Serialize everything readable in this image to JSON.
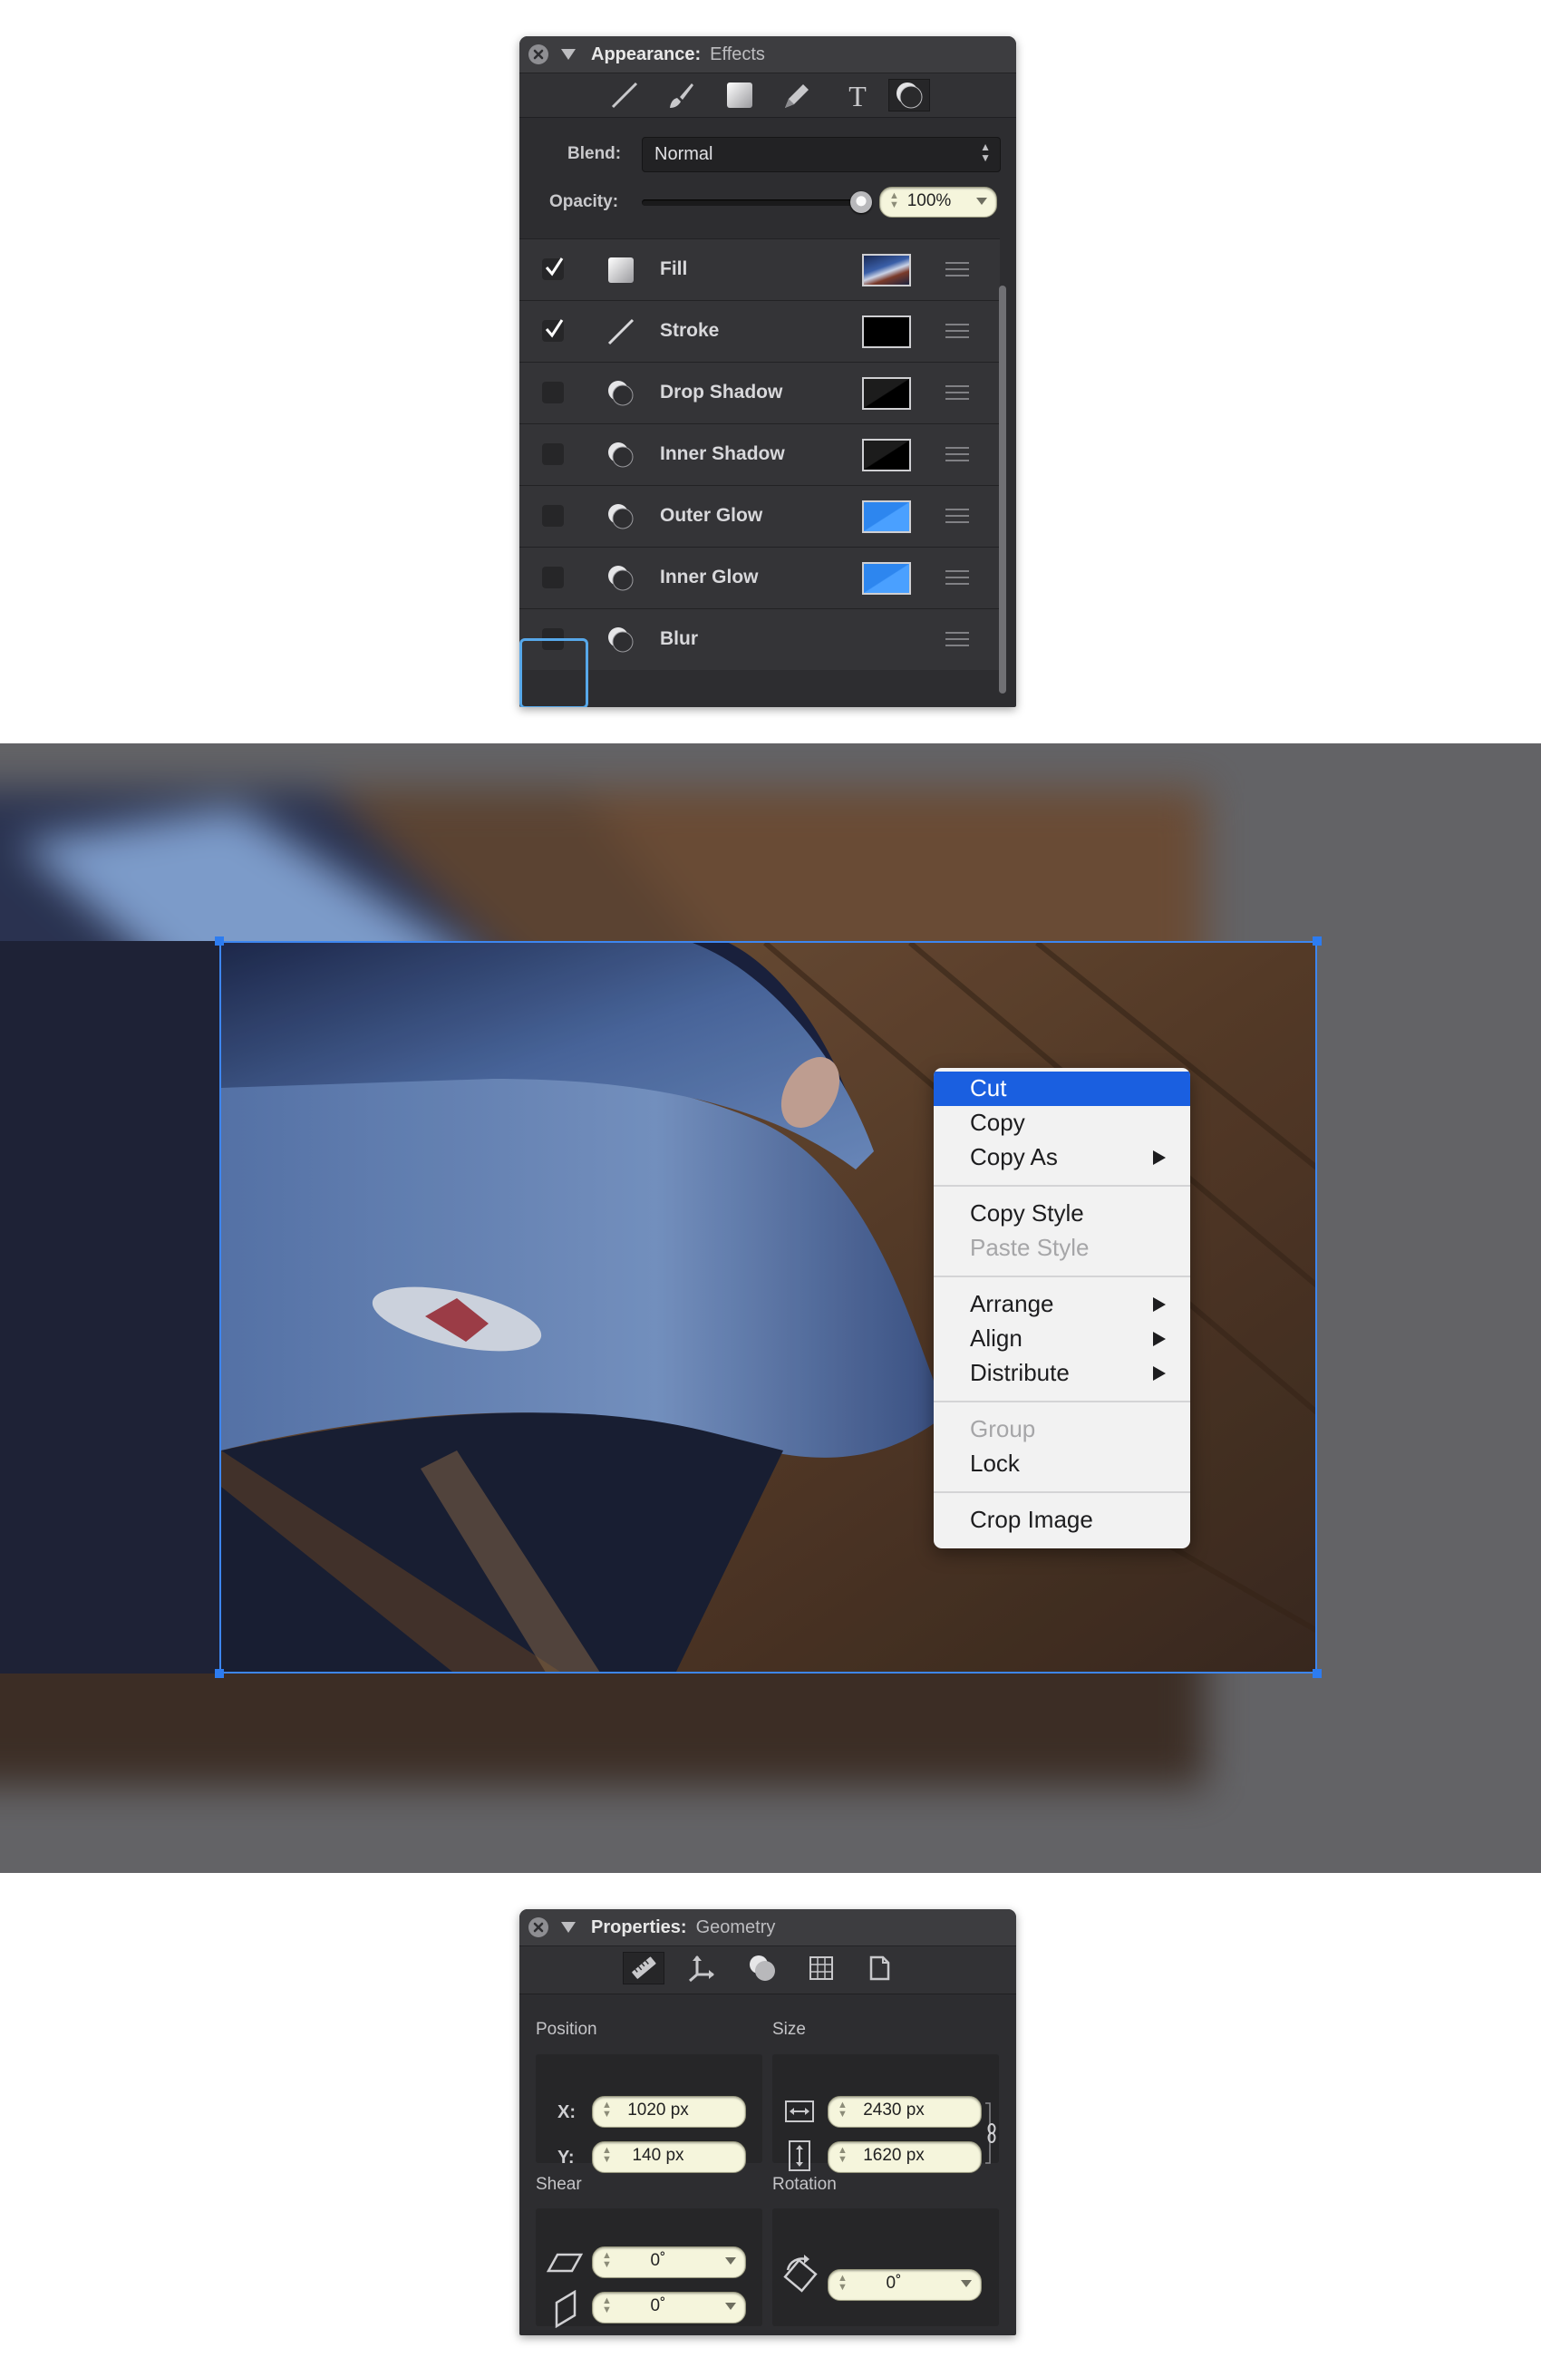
{
  "appearance_panel": {
    "title": "Appearance:",
    "subtitle": "Effects",
    "toolbar_icons": [
      "line-tool-icon",
      "brush-tool-icon",
      "fill-tool-icon",
      "pen-tool-icon",
      "text-tool-icon",
      "effects-tool-icon"
    ],
    "blend_label": "Blend:",
    "blend_value": "Normal",
    "opacity_label": "Opacity:",
    "opacity_value": "100%",
    "opacity_level": 1.0,
    "effects": [
      {
        "name": "Fill",
        "checked": true,
        "icon": "fill-swatch-icon",
        "swatch": "image"
      },
      {
        "name": "Stroke",
        "checked": true,
        "icon": "stroke-line-icon",
        "swatch": "#000000"
      },
      {
        "name": "Drop Shadow",
        "checked": false,
        "icon": "shadow-circle-icon",
        "swatch": "#000000"
      },
      {
        "name": "Inner Shadow",
        "checked": false,
        "icon": "shadow-circle-icon",
        "swatch": "#000000"
      },
      {
        "name": "Outer Glow",
        "checked": false,
        "icon": "shadow-circle-icon",
        "swatch": "#2a8cf5"
      },
      {
        "name": "Inner Glow",
        "checked": false,
        "icon": "shadow-circle-icon",
        "swatch": "#2a8cf5"
      },
      {
        "name": "Blur",
        "checked": false,
        "icon": "shadow-circle-icon",
        "swatch": ""
      }
    ],
    "add_label": "+"
  },
  "context_menu": {
    "items": [
      {
        "label": "Cut",
        "highlighted": true,
        "disabled": false,
        "submenu": false
      },
      {
        "label": "Copy",
        "highlighted": false,
        "disabled": false,
        "submenu": false
      },
      {
        "label": "Copy As",
        "highlighted": false,
        "disabled": false,
        "submenu": true
      },
      {
        "label": "Copy Style",
        "highlighted": false,
        "disabled": false,
        "submenu": false
      },
      {
        "label": "Paste Style",
        "highlighted": false,
        "disabled": true,
        "submenu": false
      },
      {
        "label": "Arrange",
        "highlighted": false,
        "disabled": false,
        "submenu": true
      },
      {
        "label": "Align",
        "highlighted": false,
        "disabled": false,
        "submenu": true
      },
      {
        "label": "Distribute",
        "highlighted": false,
        "disabled": false,
        "submenu": true
      },
      {
        "label": "Group",
        "highlighted": false,
        "disabled": true,
        "submenu": false
      },
      {
        "label": "Lock",
        "highlighted": false,
        "disabled": false,
        "submenu": false
      },
      {
        "label": "Crop Image",
        "highlighted": false,
        "disabled": false,
        "submenu": false
      }
    ]
  },
  "properties_panel": {
    "title": "Properties:",
    "subtitle": "Geometry",
    "toolbar_icons": [
      "ruler-icon",
      "anchor-icon",
      "shapes-icon",
      "grid-icon",
      "document-icon"
    ],
    "position_label": "Position",
    "size_label": "Size",
    "x_label": "X:",
    "x_value": "1020 px",
    "y_label": "Y:",
    "y_value": "140 px",
    "width_value": "2430 px",
    "height_value": "1620 px",
    "shear_label": "Shear",
    "shear_h_value": "0˚",
    "shear_v_value": "0˚",
    "rotation_label": "Rotation",
    "rotation_value": "0˚"
  },
  "colors": {
    "accent": "#1a5fe0",
    "selection": "#3d86f0",
    "focus_ring": "#57a8ea"
  }
}
